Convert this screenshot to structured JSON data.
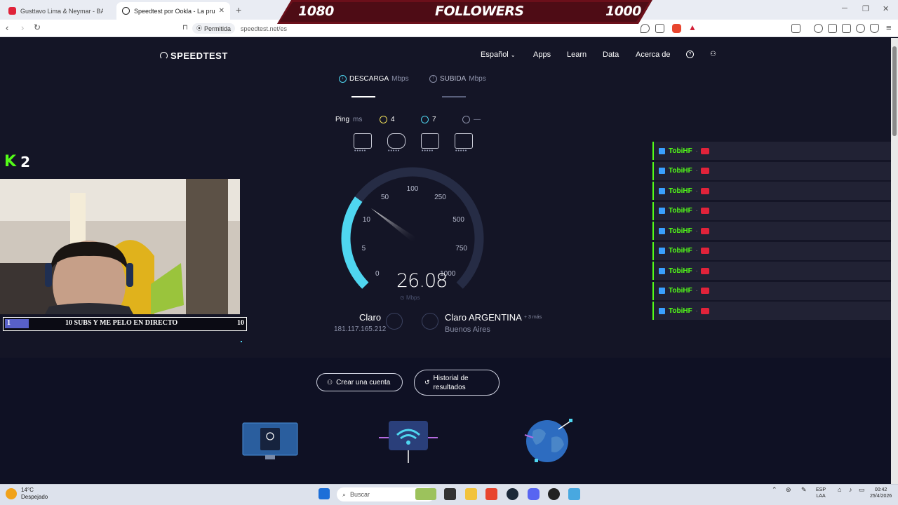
{
  "browser": {
    "tabs": [
      {
        "title": "Gusttavo Lima & Neymar - BALADA",
        "active": false,
        "favicon_color": "#e0233a"
      },
      {
        "title": "Speedtest por Ookla - La prueba",
        "active": true,
        "favicon_color": "#222"
      }
    ],
    "permission": "Permitida",
    "url": "speedtest.net/es"
  },
  "banner": {
    "left": "1080",
    "center": "FOLLOWERS",
    "right": "1000"
  },
  "speedtest": {
    "logo": "SPEEDTEST",
    "nav": [
      "Español",
      "Apps",
      "Learn",
      "Data",
      "Acerca de"
    ],
    "tabs": {
      "download_label": "DESCARGA",
      "download_unit": "Mbps",
      "upload_label": "SUBIDA",
      "upload_unit": "Mbps"
    },
    "ping": {
      "label": "Ping",
      "unit": "ms",
      "idle": "4",
      "download": "7",
      "upload": "—"
    },
    "gauge": {
      "ticks": [
        "0",
        "5",
        "10",
        "50",
        "100",
        "250",
        "500",
        "750",
        "1000"
      ],
      "value": 26.08,
      "value_text": "26.08",
      "unit": "Mbps"
    },
    "isp": {
      "name": "Claro",
      "ip": "181.117.165.212"
    },
    "server": {
      "name": "Claro ARGENTINA",
      "more": "+ 3 más",
      "city": "Buenos Aires"
    },
    "buttons": {
      "create_account": "Crear una cuenta",
      "history_line1": "Historial de",
      "history_line2": "resultados"
    }
  },
  "overlay": {
    "kick_count": "2",
    "goal": {
      "text": "10 SUBS Y ME PELO EN DIRECTO",
      "current": "1",
      "target": "10"
    },
    "chat": [
      {
        "user": "TobiHF"
      },
      {
        "user": "TobiHF"
      },
      {
        "user": "TobiHF"
      },
      {
        "user": "TobiHF"
      },
      {
        "user": "TobiHF"
      },
      {
        "user": "TobiHF"
      },
      {
        "user": "TobiHF"
      },
      {
        "user": "TobiHF"
      },
      {
        "user": "TobiHF"
      }
    ]
  },
  "taskbar": {
    "weather_temp": "14°C",
    "weather_desc": "Despejado",
    "search_placeholder": "Buscar",
    "lang_line1": "ESP",
    "lang_line2": "LAA",
    "time": "00:42",
    "date": "25/4/2026"
  },
  "colors": {
    "accent": "#4fd6f0",
    "bg": "#141526",
    "chat_name": "#53fc18"
  }
}
